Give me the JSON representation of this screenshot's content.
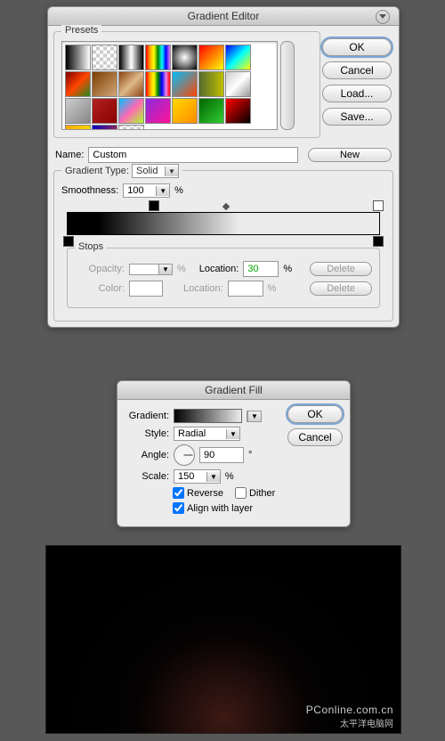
{
  "gradient_editor": {
    "title": "Gradient Editor",
    "presets_label": "Presets",
    "buttons": {
      "ok": "OK",
      "cancel": "Cancel",
      "load": "Load...",
      "save": "Save...",
      "new": "New"
    },
    "name_label": "Name:",
    "name_value": "Custom",
    "gradient_type_label": "Gradient Type:",
    "gradient_type_value": "Solid",
    "smoothness_label": "Smoothness:",
    "smoothness_value": "100",
    "percent": "%",
    "stops_label": "Stops",
    "opacity_label": "Opacity:",
    "opacity_value": "",
    "location_label": "Location:",
    "location_value": "30",
    "color_label": "Color:",
    "location2_value": "",
    "delete_label": "Delete"
  },
  "gradient_fill": {
    "title": "Gradient Fill",
    "gradient_label": "Gradient:",
    "style_label": "Style:",
    "style_value": "Radial",
    "angle_label": "Angle:",
    "angle_value": "90",
    "angle_unit": "°",
    "scale_label": "Scale:",
    "scale_value": "150",
    "percent": "%",
    "reverse_label": "Reverse",
    "reverse_checked": true,
    "dither_label": "Dither",
    "dither_checked": false,
    "align_label": "Align with layer",
    "align_checked": true,
    "buttons": {
      "ok": "OK",
      "cancel": "Cancel"
    }
  },
  "watermark": {
    "en": "PConline.com.cn",
    "cn": "太平洋电脑网"
  },
  "preset_swatches": [
    "linear-gradient(90deg,#000,#fff)",
    "repeating-conic-gradient(#ccc 0 25%,#fff 0 50%) 0/8px 8px",
    "linear-gradient(90deg,#000,#fff,#000)",
    "linear-gradient(90deg,red,orange,yellow,green,cyan,blue,violet)",
    "radial-gradient(#fff,#000)",
    "linear-gradient(135deg,red,yellow)",
    "linear-gradient(135deg,#00f,#0ff,#ff0)",
    "linear-gradient(135deg,#800000,#ff4500,#228b22)",
    "linear-gradient(135deg,#7b3f00,#d2a679)",
    "linear-gradient(135deg,#8b4513,#deb887,#8b4513)",
    "linear-gradient(90deg,red,orange,yellow,green,blue,violet,red)",
    "linear-gradient(135deg,#00bfff,#ff4500)",
    "linear-gradient(90deg,#556b2f,#bfbf00)",
    "linear-gradient(135deg,#ccc,#fff,#999)",
    "linear-gradient(135deg,#ccc,#888)",
    "linear-gradient(135deg,#b22222,#8b0000)",
    "linear-gradient(135deg,#00bfff,#ff69b4,#adff2f)",
    "linear-gradient(135deg,#8a2be2,#ff1493)",
    "linear-gradient(135deg,#ffd700,#ff8c00)",
    "linear-gradient(135deg,#006400,#32cd32)",
    "linear-gradient(135deg,#ff0000,#000)",
    "linear-gradient(135deg,#ffa500,#ffff00)",
    "linear-gradient(135deg,#0000cd,#ff4500)",
    "repeating-conic-gradient(#ccc 0 25%,#fff 0 50%) 0/8px 8px"
  ]
}
